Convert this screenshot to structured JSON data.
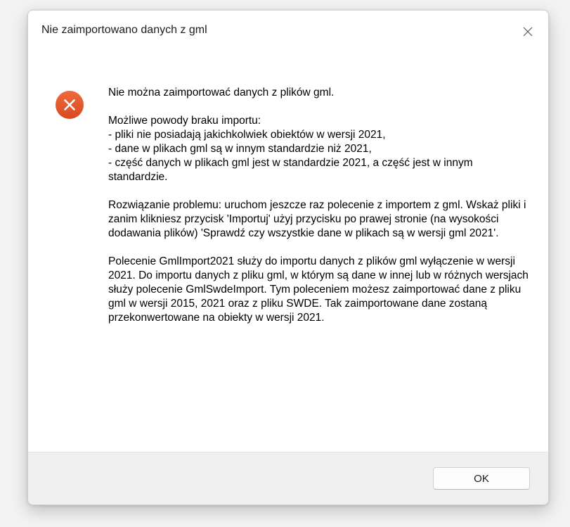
{
  "window": {
    "title": "Nie zaimportowano danych z gml"
  },
  "icons": {
    "close": "close-icon",
    "status": "error-icon"
  },
  "colors": {
    "error_red": "#e4572e",
    "footer_bg": "#f0f0f0"
  },
  "message": {
    "headline": "Nie można zaimportować danych z plików gml.",
    "reasons": "Możliwe powody braku importu:\n- pliki nie posiadają jakichkolwiek obiektów w wersji 2021,\n- dane w plikach gml są w innym standardzie niż 2021,\n- część danych w plikach gml jest w standardzie 2021, a część jest w innym standardzie.",
    "solution": "Rozwiązanie problemu: uruchom jeszcze raz polecenie z importem z gml. Wskaż pliki i zanim klikniesz przycisk 'Importuj' użyj przycisku po prawej stronie (na wysokości dodawania plików) 'Sprawdź czy wszystkie dane w plikach są w wersji gml 2021'.",
    "info": "Polecenie GmlImport2021 służy do importu danych z plików gml wyłączenie w wersji 2021. Do importu danych z pliku gml, w którym są dane w innej lub w różnych wersjach służy polecenie GmlSwdeImport. Tym poleceniem możesz zaimportować dane z pliku gml w wersji 2015, 2021 oraz z pliku SWDE. Tak zaimportowane dane zostaną przekonwertowane na obiekty w wersji 2021."
  },
  "buttons": {
    "ok_label": "OK"
  }
}
